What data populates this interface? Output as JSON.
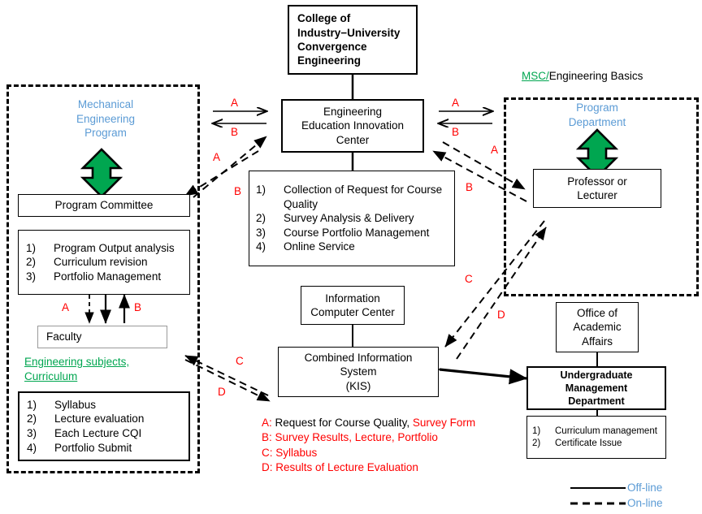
{
  "diagram": {
    "title_box": "College of\nIndustry−University\nConvergence\nEngineering",
    "center_box": "Engineering\nEducation Innovation\nCenter",
    "center_tasks": [
      {
        "n": "1)",
        "t": "Collection of Request for Course Quality"
      },
      {
        "n": "2)",
        "t": "Survey Analysis & Delivery"
      },
      {
        "n": "3)",
        "t": "Course Portfolio Management"
      },
      {
        "n": "4)",
        "t": "Online Service"
      }
    ],
    "info_computer_center": "Information\nComputer Center",
    "combined_information_system": "Combined Information\nSystem\n(KIS)"
  },
  "left_panel": {
    "heading": "Mechanical\nEngineering\nProgram",
    "heading_color": "#5b9bd5",
    "green_arrow": "up-down-arrow",
    "program_committee": "Program Committee",
    "committee_tasks": [
      {
        "n": "1)",
        "t": "Program Output analysis"
      },
      {
        "n": "2)",
        "t": "Curriculum revision"
      },
      {
        "n": "3)",
        "t": "Portfolio Management"
      }
    ],
    "faculty": "Faculty",
    "subjects_note": "Engineering subjects,\nCurriculum",
    "subjects_note_color": "#00a650",
    "faculty_tasks": [
      {
        "n": "1)",
        "t": "Syllabus"
      },
      {
        "n": "2)",
        "t": "Lecture evaluation"
      },
      {
        "n": "3)",
        "t": "Each Lecture CQI"
      },
      {
        "n": "4)",
        "t": "Portfolio Submit"
      }
    ],
    "arrow_label_a": "A",
    "arrow_label_b": "B"
  },
  "right_panel": {
    "caption_green": "MSC/",
    "caption_black": "Engineering Basics",
    "heading": "Program\nDepartment",
    "heading_color": "#5b9bd5",
    "green_arrow": "up-down-arrow",
    "professor_box": "Professor or\nLecturer",
    "office_academic_affairs": "Office of\nAcademic\nAffairs",
    "undergraduate_management": "Undergraduate\nManagement\nDepartment",
    "undergraduate_tasks": [
      {
        "n": "1)",
        "t": "Curriculum management"
      },
      {
        "n": "2)",
        "t": "Certificate Issue"
      }
    ]
  },
  "flow_labels": {
    "left_solid_a": "A",
    "left_solid_b": "B",
    "left_dashed_a": "A",
    "left_dashed_b": "B",
    "right_solid_a": "A",
    "right_solid_b": "B",
    "right_dashed_a": "A",
    "right_dashed_b": "B",
    "mid_dashed_c": "C",
    "mid_dashed_d": "D",
    "lower_dashed_c": "C",
    "lower_dashed_d": "D"
  },
  "key": {
    "lines": [
      {
        "code": "A:",
        "black": " Request for Course Quality,",
        "red": " Survey Form"
      },
      {
        "code": "B:",
        "black": "",
        "red": " Survey Results, Lecture, Portfolio"
      },
      {
        "code": "C:",
        "black": "",
        "red": " Syllabus"
      },
      {
        "code": "D:",
        "black": "",
        "red": " Results of Lecture Evaluation"
      }
    ]
  },
  "legend": {
    "offline": "Off-line",
    "online": "On-line",
    "color": "#5b9bd5"
  }
}
